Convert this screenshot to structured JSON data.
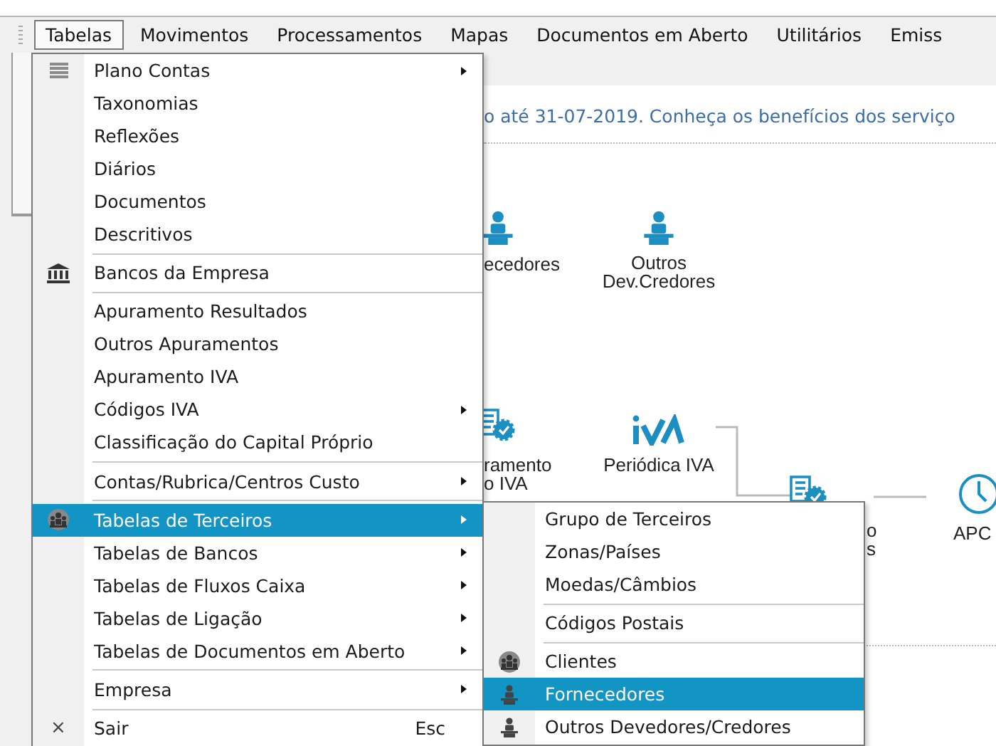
{
  "menubar": [
    {
      "label": "Tabelas",
      "selected": true
    },
    {
      "label": "Movimentos",
      "selected": false
    },
    {
      "label": "Processamentos",
      "selected": false
    },
    {
      "label": "Mapas",
      "selected": false
    },
    {
      "label": "Documentos em Aberto",
      "selected": false
    },
    {
      "label": "Utilitários",
      "selected": false
    },
    {
      "label": "Emiss",
      "selected": false
    }
  ],
  "banner": "o até 31-07-2019. Conheça os benefícios dos serviço",
  "shortcuts": [
    {
      "kind": "person-desk",
      "lines": [
        "ecedores"
      ]
    },
    {
      "kind": "person-desk",
      "lines": [
        "Outros",
        "Dev.Credores"
      ]
    },
    {
      "kind": "doc-gear",
      "lines": [
        "ramento",
        "o IVA"
      ]
    },
    {
      "kind": "logo",
      "lines": [
        "Periódica IVA"
      ]
    },
    {
      "kind": "doc-gear",
      "lines": [
        "o",
        "s"
      ]
    },
    {
      "kind": "clock",
      "lines": [
        "APC"
      ]
    }
  ],
  "menu": [
    {
      "kind": "list",
      "label": "Plano Contas",
      "submenu": true,
      "selected": false
    },
    {
      "kind": "plain",
      "label": "Taxonomias",
      "submenu": false,
      "selected": false
    },
    {
      "kind": "plain",
      "label": "Reflexões",
      "submenu": false,
      "selected": false
    },
    {
      "kind": "plain",
      "label": "Diários",
      "submenu": false,
      "selected": false
    },
    {
      "kind": "plain",
      "label": "Documentos",
      "submenu": false,
      "selected": false
    },
    {
      "kind": "plain",
      "label": "Descritivos",
      "submenu": false,
      "selected": false
    },
    {
      "kind": "separator"
    },
    {
      "kind": "bank",
      "label": "Bancos da Empresa",
      "submenu": false,
      "selected": false
    },
    {
      "kind": "separator"
    },
    {
      "kind": "plain",
      "label": "Apuramento Resultados",
      "submenu": false,
      "selected": false
    },
    {
      "kind": "plain",
      "label": "Outros Apuramentos",
      "submenu": false,
      "selected": false
    },
    {
      "kind": "plain",
      "label": "Apuramento IVA",
      "submenu": false,
      "selected": false
    },
    {
      "kind": "plain",
      "label": "Códigos IVA",
      "submenu": true,
      "selected": false
    },
    {
      "kind": "plain",
      "label": "Classificação do Capital Próprio",
      "submenu": false,
      "selected": false
    },
    {
      "kind": "separator"
    },
    {
      "kind": "plain",
      "label": "Contas/Rubrica/Centros Custo",
      "submenu": true,
      "selected": false
    },
    {
      "kind": "separator"
    },
    {
      "kind": "group",
      "label": "Tabelas de Terceiros",
      "submenu": true,
      "selected": true
    },
    {
      "kind": "plain",
      "label": "Tabelas de Bancos",
      "submenu": true,
      "selected": false
    },
    {
      "kind": "plain",
      "label": "Tabelas de Fluxos Caixa",
      "submenu": true,
      "selected": false
    },
    {
      "kind": "plain",
      "label": "Tabelas de Ligação",
      "submenu": true,
      "selected": false
    },
    {
      "kind": "plain",
      "label": "Tabelas de Documentos em Aberto",
      "submenu": true,
      "selected": false
    },
    {
      "kind": "separator"
    },
    {
      "kind": "plain",
      "label": "Empresa",
      "submenu": true,
      "selected": false
    },
    {
      "kind": "separator"
    },
    {
      "kind": "exit",
      "glyph": "×",
      "label": "Sair",
      "shortcut": "Esc",
      "submenu": false,
      "selected": false
    }
  ],
  "submenu": [
    {
      "kind": "plain",
      "label": "Grupo de Terceiros",
      "submenu": false,
      "selected": false
    },
    {
      "kind": "plain",
      "label": "Zonas/Países",
      "submenu": false,
      "selected": false
    },
    {
      "kind": "plain",
      "label": "Moedas/Câmbios",
      "submenu": false,
      "selected": false
    },
    {
      "kind": "separator"
    },
    {
      "kind": "plain",
      "label": "Códigos Postais",
      "submenu": false,
      "selected": false
    },
    {
      "kind": "separator"
    },
    {
      "kind": "group",
      "label": "Clientes",
      "submenu": false,
      "selected": false
    },
    {
      "kind": "person-desk",
      "label": "Fornecedores",
      "submenu": false,
      "selected": true
    },
    {
      "kind": "person-desk",
      "label": "Outros Devedores/Credores",
      "submenu": false,
      "selected": false
    }
  ]
}
